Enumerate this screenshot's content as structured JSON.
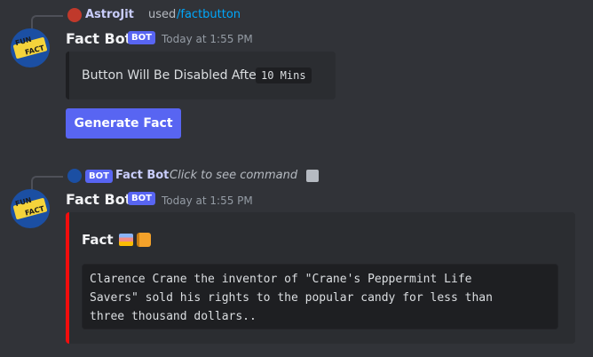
{
  "message1": {
    "reply": {
      "username": "AstroJit",
      "used_text": "used",
      "command": "/factbutton"
    },
    "avatar_text_top": "FUN",
    "avatar_text_bottom": "FACT",
    "username": "Fact Bot",
    "bot_tag": "BOT",
    "timestamp": "Today at 1:55 PM",
    "embed_text": "Button Will Be Disabled After",
    "embed_code": "10 Mins",
    "button_label": "Generate Fact"
  },
  "message2": {
    "reply": {
      "bot_tag": "BOT",
      "username": "Fact Bot",
      "hint": "Click to see command"
    },
    "avatar_text_top": "FUN",
    "avatar_text_bottom": "FACT",
    "username": "Fact Bot",
    "bot_tag": "BOT",
    "timestamp": "Today at 1:55 PM",
    "embed_title": "Fact",
    "embed_accent_color": "#f20d0d",
    "fact_lines": [
      "Clarence Crane the inventor of \"Crane's Peppermint Life",
      "Savers\" sold his rights to the popular candy for less than",
      "three thousand dollars.."
    ]
  },
  "icons": [
    "user-avatar-icon",
    "bot-avatar-icon",
    "books-emoji-icon",
    "book-emoji-icon",
    "edit-icon"
  ],
  "colors": {
    "background": "#313338",
    "blurple": "#5865f2",
    "link": "#00a8fc",
    "embed_bg": "#2b2d31"
  }
}
